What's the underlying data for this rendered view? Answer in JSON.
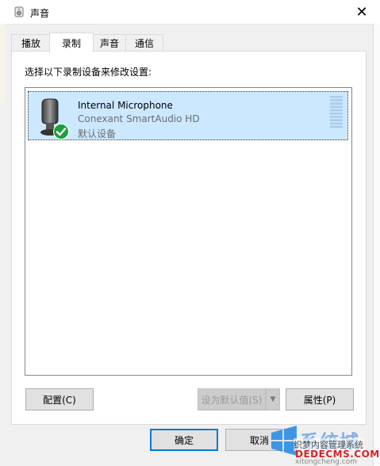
{
  "window": {
    "title": "声音",
    "close_glyph": "✕"
  },
  "tabs": [
    {
      "label": "播放",
      "active": false
    },
    {
      "label": "录制",
      "active": true
    },
    {
      "label": "声音",
      "active": false
    },
    {
      "label": "通信",
      "active": false
    }
  ],
  "recording": {
    "instruction": "选择以下录制设备来修改设置:",
    "devices": [
      {
        "name": "Internal Microphone",
        "driver": "Conexant SmartAudio HD",
        "status": "默认设备",
        "icon": "microphone-icon",
        "default_badge": "check-icon",
        "level": 0.0
      }
    ]
  },
  "buttons": {
    "configure": "配置(C)",
    "set_default": "设为默认值(S)",
    "properties": "属性(P)",
    "ok": "确定",
    "cancel": "取消"
  },
  "watermark": {
    "brand": "系统城",
    "line1": "织梦内容管理系统",
    "line2": "DEDECMS.COM",
    "line3": "xitongcheng.com"
  },
  "colors": {
    "selection": "#cce8ff",
    "primary_border": "#0078d7",
    "check_green": "#1e9e3c"
  }
}
